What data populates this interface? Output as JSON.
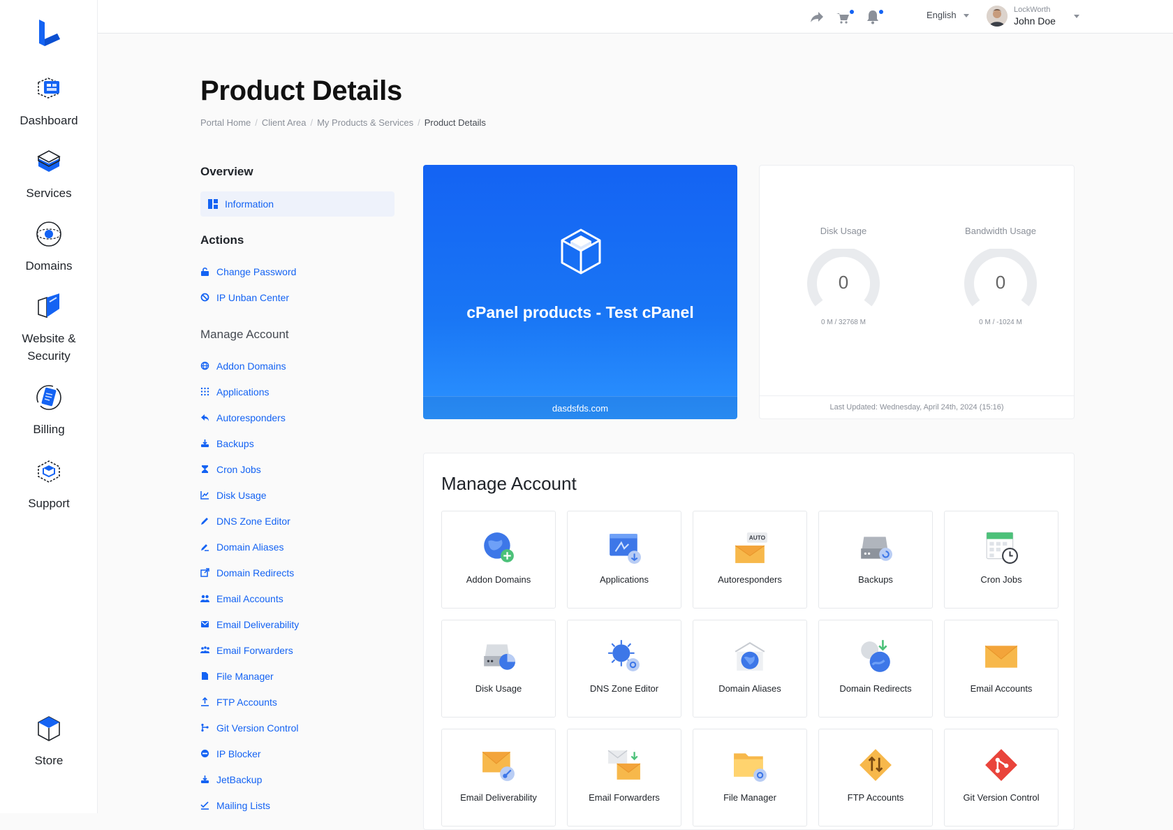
{
  "nav": {
    "items": [
      {
        "label": "Dashboard"
      },
      {
        "label": "Services"
      },
      {
        "label": "Domains"
      },
      {
        "label": "Website &"
      },
      {
        "label": "Billing"
      },
      {
        "label": "Support"
      },
      {
        "label": "Store"
      }
    ],
    "website_line2": "Security"
  },
  "topbar": {
    "language": "English",
    "user_company": "LockWorth",
    "user_name": "John Doe"
  },
  "page": {
    "title": "Product Details",
    "breadcrumb": [
      "Portal Home",
      "Client Area",
      "My Products & Services",
      "Product Details"
    ]
  },
  "sidebar": {
    "overview_title": "Overview",
    "overview_item": "Information",
    "actions_title": "Actions",
    "actions": [
      "Change Password",
      "IP Unban Center"
    ],
    "manage_title": "Manage Account",
    "manage_links": [
      "Addon Domains",
      "Applications",
      "Autoresponders",
      "Backups",
      "Cron Jobs",
      "Disk Usage",
      "DNS Zone Editor",
      "Domain Aliases",
      "Domain Redirects",
      "Email Accounts",
      "Email Deliverability",
      "Email Forwarders",
      "File Manager",
      "FTP Accounts",
      "Git Version Control",
      "IP Blocker",
      "JetBackup",
      "Mailing Lists"
    ]
  },
  "hero": {
    "product": "cPanel products - Test cPanel",
    "domain": "dasdsfds.com"
  },
  "usage": {
    "disk_title": "Disk Usage",
    "disk_value": "0",
    "disk_sub": "0 M / 32768 M",
    "bw_title": "Bandwidth Usage",
    "bw_value": "0",
    "bw_sub": "0 M / -1024 M",
    "updated": "Last Updated: Wednesday, April 24th, 2024 (15:16)"
  },
  "manage": {
    "title": "Manage Account",
    "tiles": [
      "Addon Domains",
      "Applications",
      "Autoresponders",
      "Backups",
      "Cron Jobs",
      "Disk Usage",
      "DNS Zone Editor",
      "Domain Aliases",
      "Domain Redirects",
      "Email Accounts",
      "Email Deliverability",
      "Email Forwarders",
      "File Manager",
      "FTP Accounts",
      "Git Version Control"
    ],
    "autoresponder_badge": "AUTO"
  },
  "colors": {
    "accent": "#1463f3",
    "text": "#1f2329",
    "muted": "#8b9099"
  }
}
